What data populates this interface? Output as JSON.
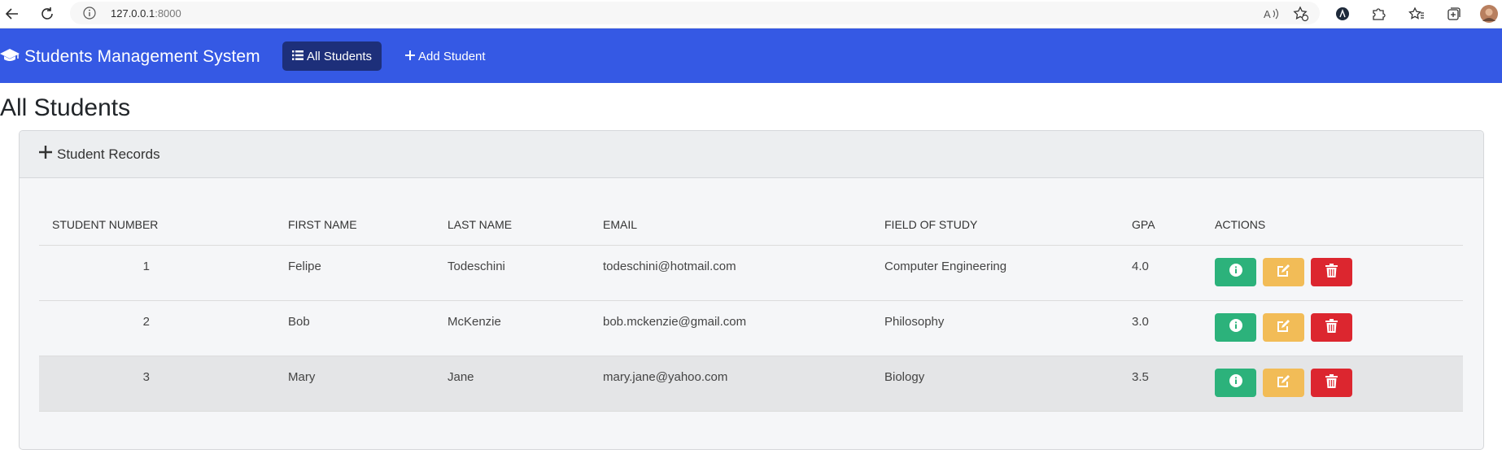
{
  "browser": {
    "url_host": "127.0.0.1",
    "url_port": ":8000"
  },
  "navbar": {
    "brand": "Students Management System",
    "links": [
      {
        "label": "All Students",
        "active": true
      },
      {
        "label": "Add Student",
        "active": false
      }
    ],
    "color": "#3559e4"
  },
  "page": {
    "title": "All Students"
  },
  "card": {
    "header": "Student Records"
  },
  "table": {
    "columns": [
      "STUDENT NUMBER",
      "FIRST NAME",
      "LAST NAME",
      "EMAIL",
      "FIELD OF STUDY",
      "GPA",
      "ACTIONS"
    ],
    "rows": [
      {
        "number": "1",
        "first": "Felipe",
        "last": "Todeschini",
        "email": "todeschini@hotmail.com",
        "field": "Computer Engineering",
        "gpa": "4.0"
      },
      {
        "number": "2",
        "first": "Bob",
        "last": "McKenzie",
        "email": "bob.mckenzie@gmail.com",
        "field": "Philosophy",
        "gpa": "3.0"
      },
      {
        "number": "3",
        "first": "Mary",
        "last": "Jane",
        "email": "mary.jane@yahoo.com",
        "field": "Biology",
        "gpa": "3.5"
      }
    ]
  },
  "action_icons": [
    "info-icon",
    "edit-icon",
    "trash-icon"
  ],
  "colors": {
    "info": "#2cb27b",
    "edit": "#f2bc57",
    "delete": "#dc262f"
  }
}
